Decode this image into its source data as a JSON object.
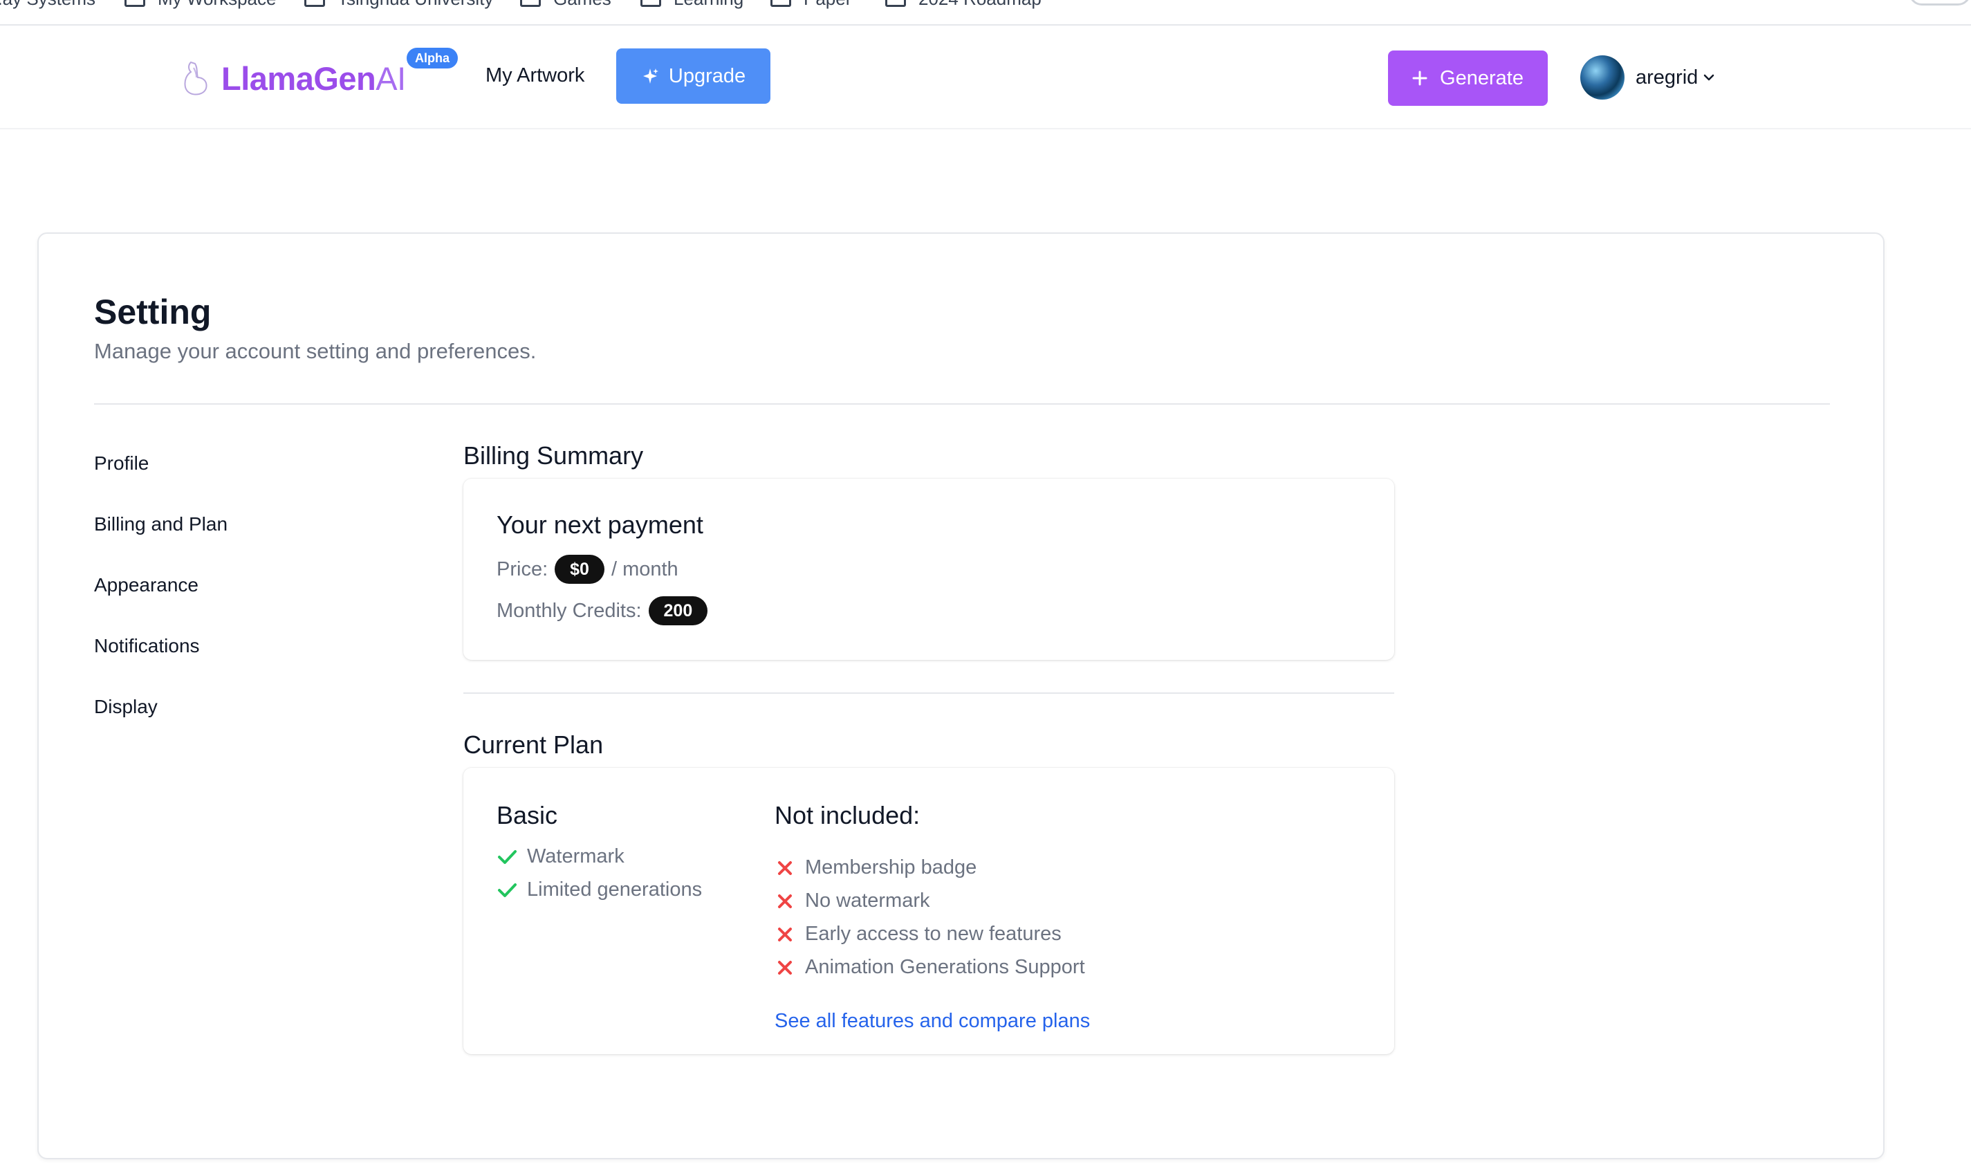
{
  "bookmarks": {
    "items": [
      {
        "label": "...ay Systems",
        "folder": false
      },
      {
        "label": "My Workspace",
        "folder": true
      },
      {
        "label": "Tsinghua University",
        "folder": true
      },
      {
        "label": "Games",
        "folder": true
      },
      {
        "label": "Learning",
        "folder": true
      },
      {
        "label": "Paper",
        "folder": true
      },
      {
        "label": "2024 Roadmap",
        "folder": true
      }
    ]
  },
  "header": {
    "logo_main": "LlamaGen",
    "logo_ai": "AI",
    "badge": "Alpha",
    "nav_artwork": "My Artwork",
    "upgrade_label": "Upgrade",
    "generate_label": "Generate",
    "username": "aregrid"
  },
  "settings": {
    "title": "Setting",
    "subtitle": "Manage your account setting and preferences.",
    "nav": [
      "Profile",
      "Billing and Plan",
      "Appearance",
      "Notifications",
      "Display"
    ]
  },
  "billing": {
    "section_title": "Billing Summary",
    "card_title": "Your next payment",
    "price_label": "Price:",
    "price_value": "$0",
    "price_period": "/ month",
    "credits_label": "Monthly Credits:",
    "credits_value": "200"
  },
  "plan": {
    "section_title": "Current Plan",
    "name": "Basic",
    "included": [
      "Watermark",
      "Limited generations"
    ],
    "not_included_title": "Not included:",
    "not_included": [
      "Membership badge",
      "No watermark",
      "Early access to new features",
      "Animation Generations Support"
    ],
    "compare_link": "See all features and compare plans"
  },
  "colors": {
    "brand": "#9b4dea",
    "upgrade": "#4f8ff7",
    "generate": "#a855f7",
    "check": "#22c55e",
    "cross": "#ef4444",
    "link": "#2563eb"
  }
}
